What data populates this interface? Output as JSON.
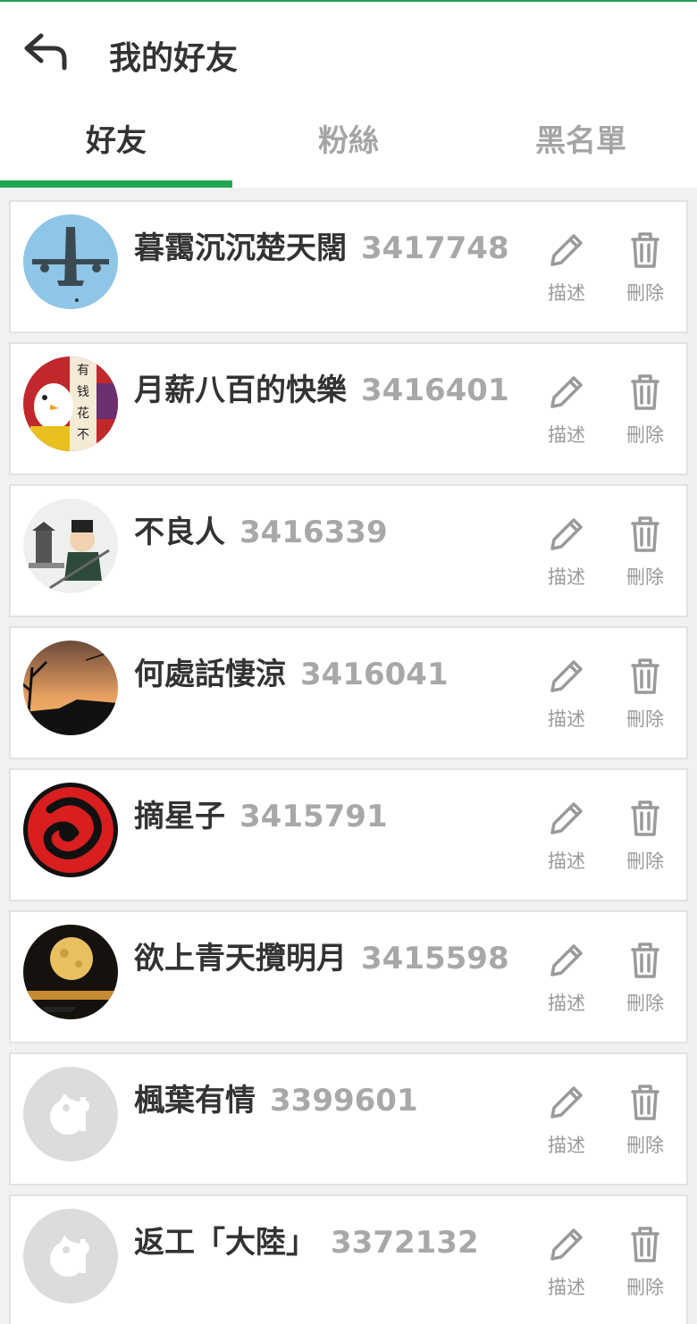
{
  "header": {
    "title": "我的好友"
  },
  "tabs": [
    {
      "label": "好友",
      "active": true
    },
    {
      "label": "粉絲",
      "active": false
    },
    {
      "label": "黑名單",
      "active": false
    }
  ],
  "actions": {
    "describe_label": "描述",
    "delete_label": "刪除"
  },
  "friends": [
    {
      "name": "暮靄沉沉楚天闊",
      "id": "3417748",
      "avatar": "avatar-airplane-sky"
    },
    {
      "name": "月薪八百的快樂",
      "id": "3416401",
      "avatar": "avatar-cartoon-duck"
    },
    {
      "name": "不良人",
      "id": "3416339",
      "avatar": "avatar-cartoon-swordsman"
    },
    {
      "name": "何處話悽涼",
      "id": "3416041",
      "avatar": "avatar-sunset-silhouette"
    },
    {
      "name": "摘星子",
      "id": "3415791",
      "avatar": "avatar-red-dragon-emblem"
    },
    {
      "name": "欲上青天攬明月",
      "id": "3415598",
      "avatar": "avatar-full-moon-night"
    },
    {
      "name": "楓葉有情",
      "id": "3399601",
      "avatar": "avatar-default-placeholder"
    },
    {
      "name": "返工「大陸」",
      "id": "3372132",
      "avatar": "avatar-default-placeholder"
    }
  ],
  "colors": {
    "accent": "#1fa84f",
    "text": "#333333",
    "muted": "#a8a8a8"
  }
}
